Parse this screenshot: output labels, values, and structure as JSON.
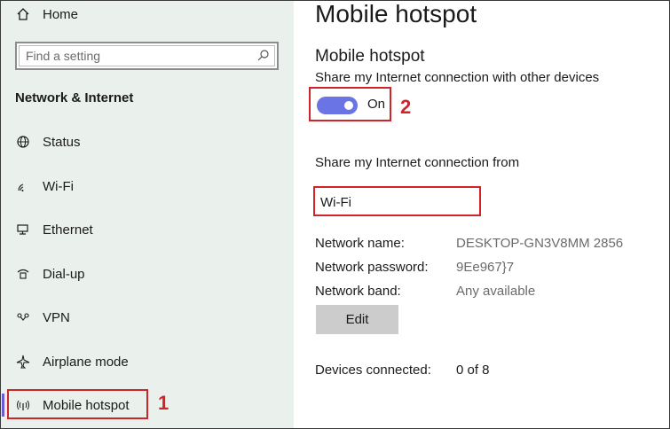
{
  "sidebar": {
    "home_label": "Home",
    "search_placeholder": "Find a setting",
    "section_title": "Network & Internet",
    "items": [
      {
        "label": "Status",
        "icon": "globe-icon"
      },
      {
        "label": "Wi-Fi",
        "icon": "wifi-icon"
      },
      {
        "label": "Ethernet",
        "icon": "ethernet-icon"
      },
      {
        "label": "Dial-up",
        "icon": "dialup-icon"
      },
      {
        "label": "VPN",
        "icon": "vpn-icon"
      },
      {
        "label": "Airplane mode",
        "icon": "airplane-icon"
      },
      {
        "label": "Mobile hotspot",
        "icon": "hotspot-icon",
        "active": true
      }
    ],
    "annotation_step": "1"
  },
  "main": {
    "page_title": "Mobile hotspot",
    "section_title": "Mobile hotspot",
    "share_label": "Share my Internet connection with other devices",
    "toggle_state": "On",
    "annotation_step": "2",
    "share_from_label": "Share my Internet connection from",
    "share_from_value": "Wi-Fi",
    "network_name_label": "Network name:",
    "network_name_value": "DESKTOP-GN3V8MM 2856",
    "network_password_label": "Network password:",
    "network_password_value": "9Ee967}7",
    "network_band_label": "Network band:",
    "network_band_value": "Any available",
    "edit_label": "Edit",
    "devices_label": "Devices connected:",
    "devices_value": "0 of 8"
  },
  "colors": {
    "sidebar_bg": "#eaf1ec",
    "toggle_on": "#6b74e4",
    "annotation_red": "#d0242b",
    "accent": "#6b5cd6"
  }
}
